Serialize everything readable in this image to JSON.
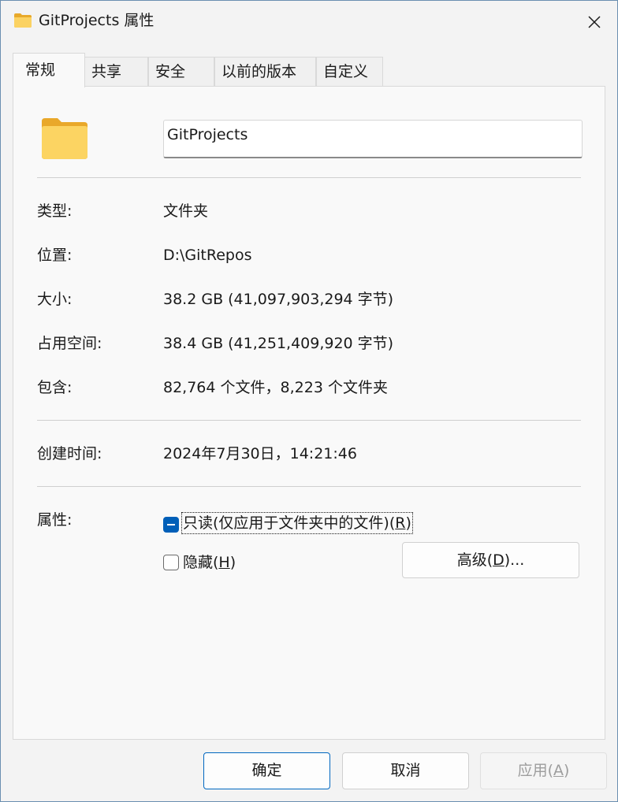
{
  "window": {
    "title": "GitProjects 属性"
  },
  "tabs": [
    {
      "label": "常规",
      "active": true
    },
    {
      "label": "共享"
    },
    {
      "label": "安全"
    },
    {
      "label": "以前的版本"
    },
    {
      "label": "自定义"
    }
  ],
  "general": {
    "folder_name": "GitProjects",
    "type_label": "类型:",
    "type_value": "文件夹",
    "location_label": "位置:",
    "location_value": "D:\\GitRepos",
    "size_label": "大小:",
    "size_value": "38.2 GB (41,097,903,294 字节)",
    "disk_label": "占用空间:",
    "disk_value": "38.4 GB (41,251,409,920 字节)",
    "contains_label": "包含:",
    "contains_value": "82,764 个文件，8,223 个文件夹",
    "created_label": "创建时间:",
    "created_value": "2024年7月30日，14:21:46",
    "attributes_label": "属性:",
    "readonly_label": "只读(仅应用于文件夹中的文件)(",
    "readonly_key": "R",
    "readonly_state": "indeterminate",
    "hidden_label": "隐藏(",
    "hidden_key": "H",
    "hidden_state": "unchecked",
    "advanced_label": "高级(",
    "advanced_key": "D",
    "advanced_suffix": ")..."
  },
  "footer": {
    "ok": "确定",
    "cancel": "取消",
    "apply_label": "应用(",
    "apply_key": "A"
  },
  "colors": {
    "accent": "#005fb8",
    "folder": "#f8c84a"
  }
}
